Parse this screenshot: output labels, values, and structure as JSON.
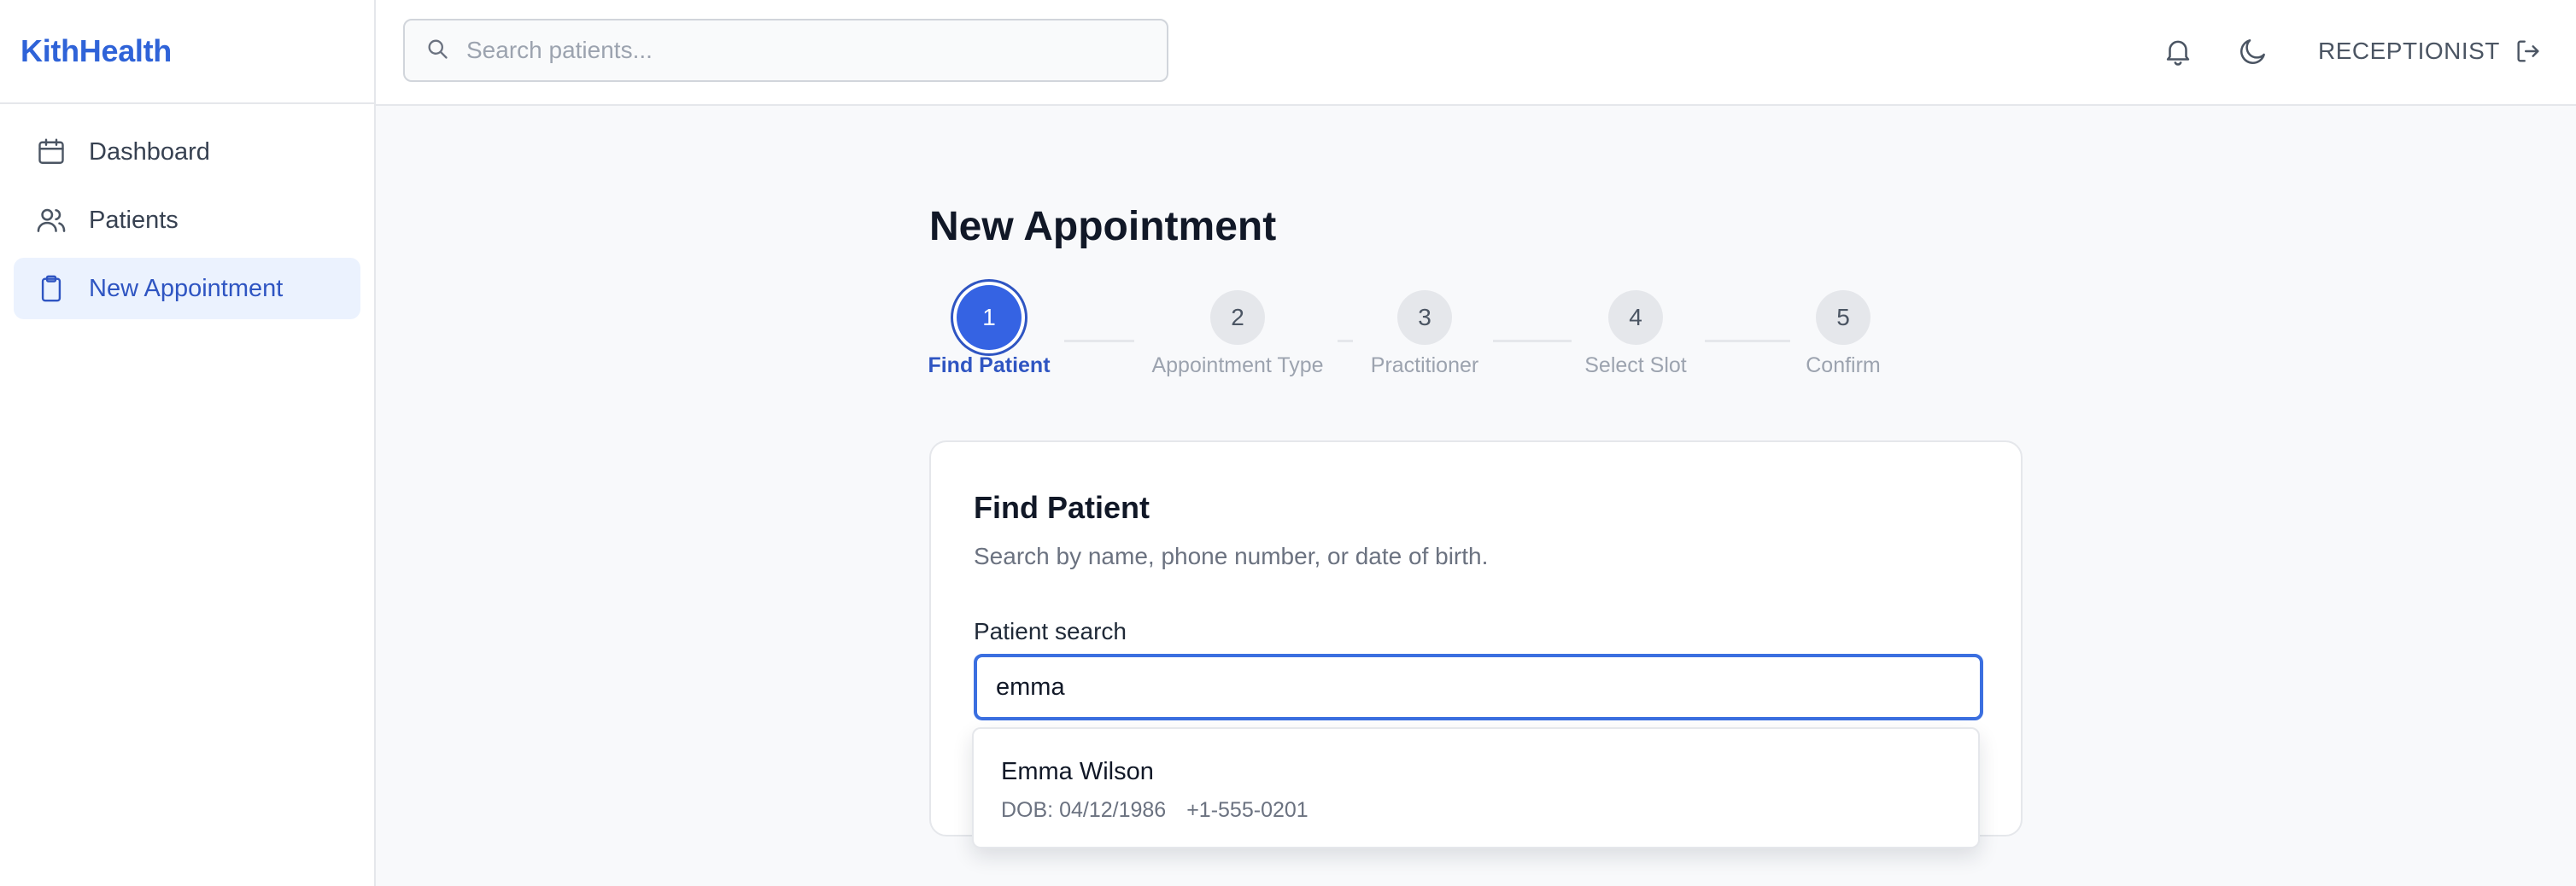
{
  "app": {
    "brand": "KithHealth"
  },
  "sidebar": {
    "items": [
      {
        "label": "Dashboard",
        "icon": "calendar-icon",
        "active": false
      },
      {
        "label": "Patients",
        "icon": "users-icon",
        "active": false
      },
      {
        "label": "New Appointment",
        "icon": "clipboard-icon",
        "active": true
      }
    ]
  },
  "header": {
    "search_placeholder": "Search patients...",
    "notifications_icon": "bell-icon",
    "theme_icon": "moon-icon",
    "role": "RECEPTIONIST",
    "logout_icon": "logout-icon"
  },
  "main": {
    "title": "New Appointment",
    "steps": [
      {
        "number": "1",
        "label": "Find Patient",
        "current": true
      },
      {
        "number": "2",
        "label": "Appointment Type",
        "current": false
      },
      {
        "number": "3",
        "label": "Practitioner",
        "current": false
      },
      {
        "number": "4",
        "label": "Select Slot",
        "current": false
      },
      {
        "number": "5",
        "label": "Confirm",
        "current": false
      }
    ],
    "card": {
      "title": "Find Patient",
      "subtitle": "Search by name, phone number, or date of birth.",
      "field_label": "Patient search",
      "field_value": "emma"
    },
    "results": [
      {
        "name": "Emma Wilson",
        "dob": "DOB: 04/12/1986",
        "phone": "+1-555-0201"
      }
    ]
  },
  "colors": {
    "accent": "#2f63d8",
    "active_bg": "#ebf2fe",
    "focus_border": "#3b6fe0"
  }
}
